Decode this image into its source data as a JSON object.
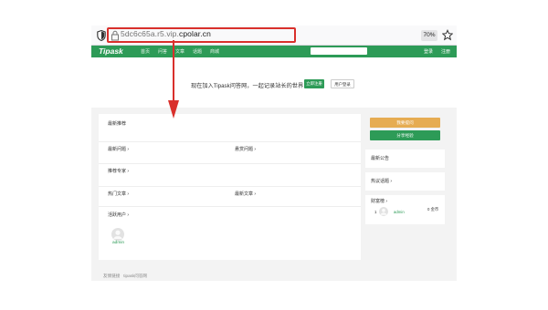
{
  "browser": {
    "url_prefix": "5dc6c65a.r5.vip.",
    "url_domain": "cpolar.cn",
    "zoom": "70%"
  },
  "nav": {
    "brand": "Tipask",
    "items": [
      "首页",
      "问答",
      "文章",
      "话题",
      "商城"
    ],
    "login": "登录",
    "register": "注册"
  },
  "welcome": {
    "text": "现在加入Tipask问答网，一起记录站长的世界",
    "register_button": "立即注册",
    "login_button": "用户登录"
  },
  "main": {
    "recommend_title": "最新推荐",
    "latest_questions": "最新问题 ›",
    "bounty_questions": "悬赏问题 ›",
    "recommended_experts": "推荐专家 ›",
    "hot_articles": "热门文章 ›",
    "latest_articles": "最新文章 ›",
    "active_users": "活跃用户 ›",
    "active_user_name": "admin"
  },
  "sidebar": {
    "ask_button": "我要提问",
    "share_button": "分享经验",
    "announcements": "最新公告",
    "hot_topics": "热议话题 ›",
    "wealth_rank": "财富榜 ›",
    "rank_number": "1",
    "rank_user": "admin",
    "rank_value": "0 金币"
  },
  "footer": {
    "links_label": "友情链接",
    "link_1": "tipask问答网"
  },
  "colors": {
    "brand_green": "#2d9b57",
    "ask_orange": "#e6ac52",
    "highlight_red": "#d9302c"
  }
}
